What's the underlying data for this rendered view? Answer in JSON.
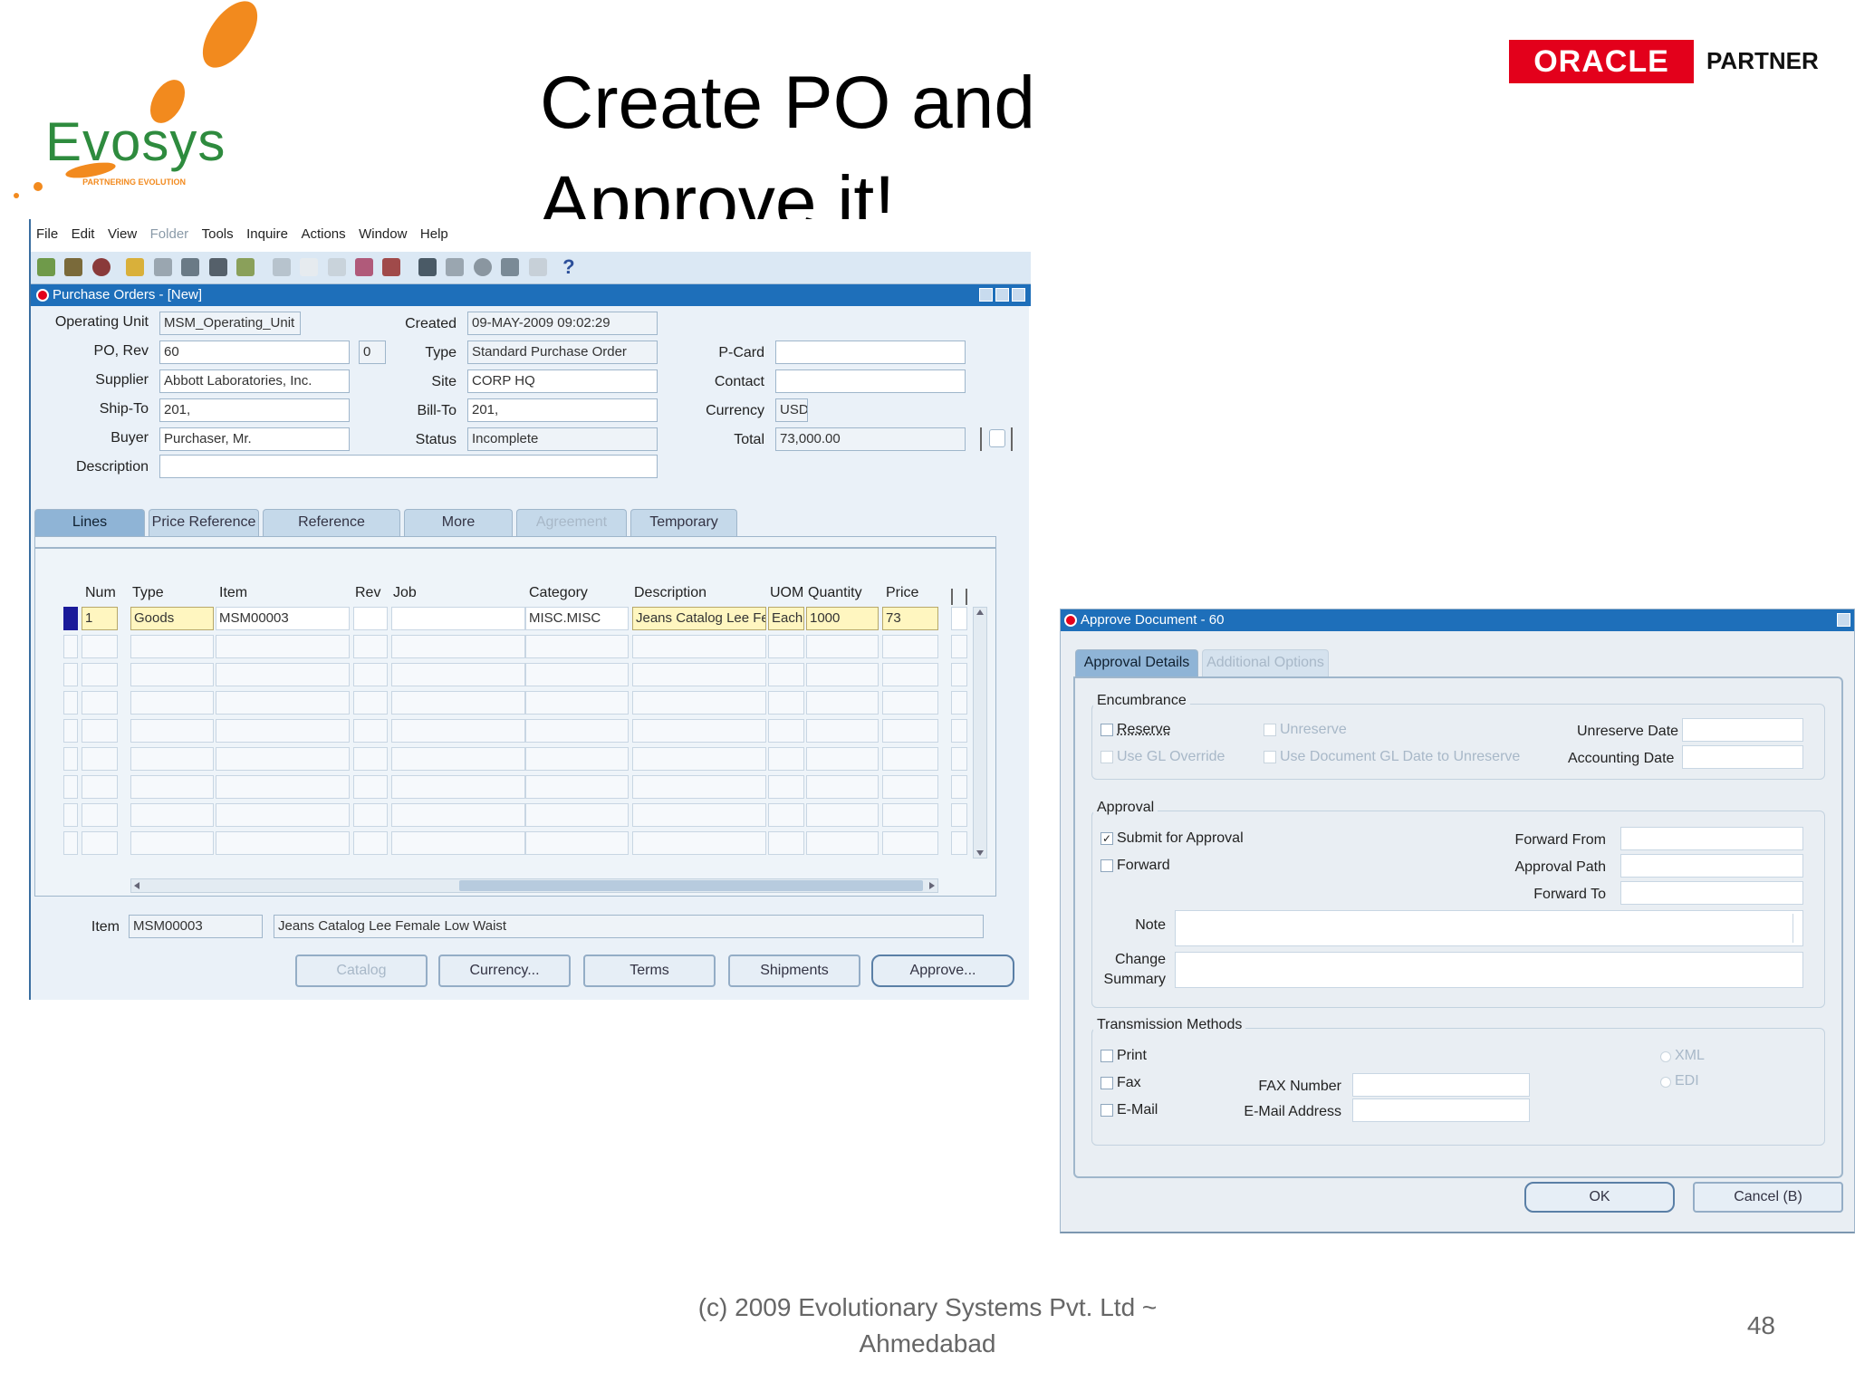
{
  "slide": {
    "title_line1": "Create PO and",
    "title_line2": "Approve it!",
    "logo_text": "Evosys",
    "logo_tagline": "PARTNERING EVOLUTION",
    "oracle_logo": "ORACLE",
    "partner_label": "PARTNER",
    "footer_line1": "(c) 2009 Evolutionary Systems Pvt. Ltd ~",
    "footer_line2": "Ahmedabad",
    "page_number": "48"
  },
  "colors": {
    "titlebar": "#1e6fba",
    "oracle_red": "#e3001b",
    "evosys_orange": "#f28a1e",
    "evosys_green": "#2e8b3e"
  },
  "menu": {
    "items": [
      {
        "label": "File",
        "disabled": false
      },
      {
        "label": "Edit",
        "disabled": false
      },
      {
        "label": "View",
        "disabled": false
      },
      {
        "label": "Folder",
        "disabled": true
      },
      {
        "label": "Tools",
        "disabled": false
      },
      {
        "label": "Inquire",
        "disabled": false
      },
      {
        "label": "Actions",
        "disabled": false
      },
      {
        "label": "Window",
        "disabled": false
      },
      {
        "label": "Help",
        "disabled": false
      }
    ]
  },
  "po_window": {
    "title": "Purchase Orders - [New]",
    "header": {
      "operating_unit_label": "Operating Unit",
      "operating_unit_value": "MSM_Operating_Unit",
      "po_rev_label": "PO, Rev",
      "po_value": "60",
      "rev_value": "0",
      "supplier_label": "Supplier",
      "supplier_value": "Abbott Laboratories, Inc.",
      "ship_to_label": "Ship-To",
      "ship_to_value": "201,",
      "buyer_label": "Buyer",
      "buyer_value": "Purchaser, Mr.",
      "description_label": "Description",
      "description_value": "",
      "created_label": "Created",
      "created_value": "09-MAY-2009 09:02:29",
      "type_label": "Type",
      "type_value": "Standard Purchase Order",
      "site_label": "Site",
      "site_value": "CORP HQ",
      "bill_to_label": "Bill-To",
      "bill_to_value": "201,",
      "status_label": "Status",
      "status_value": "Incomplete",
      "pcard_label": "P-Card",
      "pcard_value": "",
      "contact_label": "Contact",
      "contact_value": "",
      "currency_label": "Currency",
      "currency_value": "USD",
      "total_label": "Total",
      "total_value": "73,000.00"
    },
    "tabs": [
      {
        "label": "Lines",
        "state": "active"
      },
      {
        "label": "Price Reference",
        "state": "normal"
      },
      {
        "label": "Reference Documents",
        "state": "normal"
      },
      {
        "label": "More",
        "state": "normal"
      },
      {
        "label": "Agreement",
        "state": "disabled"
      },
      {
        "label": "Temporary Labor",
        "state": "normal"
      }
    ],
    "columns": [
      "Num",
      "Type",
      "Item",
      "Rev",
      "Job",
      "Category",
      "Description",
      "UOM",
      "Quantity",
      "Price"
    ],
    "row": {
      "num": "1",
      "type": "Goods",
      "item": "MSM00003",
      "rev": "",
      "job": "",
      "category": "MISC.MISC",
      "description": "Jeans Catalog Lee Fer",
      "uom": "Each",
      "quantity": "1000",
      "price": "73"
    },
    "footer_item_label": "Item",
    "footer_item_value": "MSM00003",
    "footer_item_desc": "Jeans Catalog Lee Female Low Waist",
    "buttons": [
      {
        "label": "Catalog",
        "disabled": true
      },
      {
        "label": "Currency...",
        "disabled": false
      },
      {
        "label": "Terms",
        "disabled": false
      },
      {
        "label": "Shipments",
        "disabled": false
      },
      {
        "label": "Approve...",
        "disabled": false
      }
    ]
  },
  "approve_dialog": {
    "title": "Approve Document - 60",
    "tabs": [
      {
        "label": "Approval Details",
        "state": "active"
      },
      {
        "label": "Additional Options",
        "state": "disabled"
      }
    ],
    "encumbrance": {
      "title": "Encumbrance",
      "reserve": "Reserve",
      "unreserve": "Unreserve",
      "use_gl_override": "Use GL Override",
      "use_doc_gl_date": "Use Document GL Date to Unreserve",
      "unreserve_date_label": "Unreserve Date",
      "accounting_date_label": "Accounting Date"
    },
    "approval": {
      "title": "Approval",
      "submit_for_approval": "Submit for Approval",
      "submit_checked": true,
      "forward": "Forward",
      "forward_from_label": "Forward From",
      "approval_path_label": "Approval Path",
      "forward_to_label": "Forward To",
      "note_label": "Note",
      "change_summary_label_1": "Change",
      "change_summary_label_2": "Summary"
    },
    "transmission": {
      "title": "Transmission Methods",
      "print": "Print",
      "fax": "Fax",
      "email": "E-Mail",
      "fax_number_label": "FAX Number",
      "email_address_label": "E-Mail Address",
      "xml": "XML",
      "edi": "EDI"
    },
    "ok_label": "OK",
    "cancel_label": "Cancel (B)"
  }
}
